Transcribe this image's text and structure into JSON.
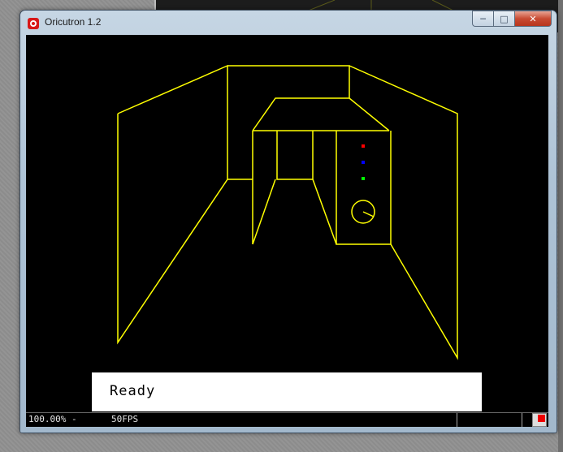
{
  "window": {
    "title": "Oricutron 1.2",
    "icon": "oricutron-icon"
  },
  "caption_buttons": {
    "minimize": "minimize-icon",
    "maximize": "maximize-icon",
    "close": "close-icon"
  },
  "screen": {
    "wireframe_color": "#ffff00",
    "indicator_colors": [
      "#ff0000",
      "#0000ff",
      "#00ff00"
    ],
    "status_text": "Ready"
  },
  "statusbar": {
    "zoom": "100.00% -",
    "fps": "50FPS"
  }
}
